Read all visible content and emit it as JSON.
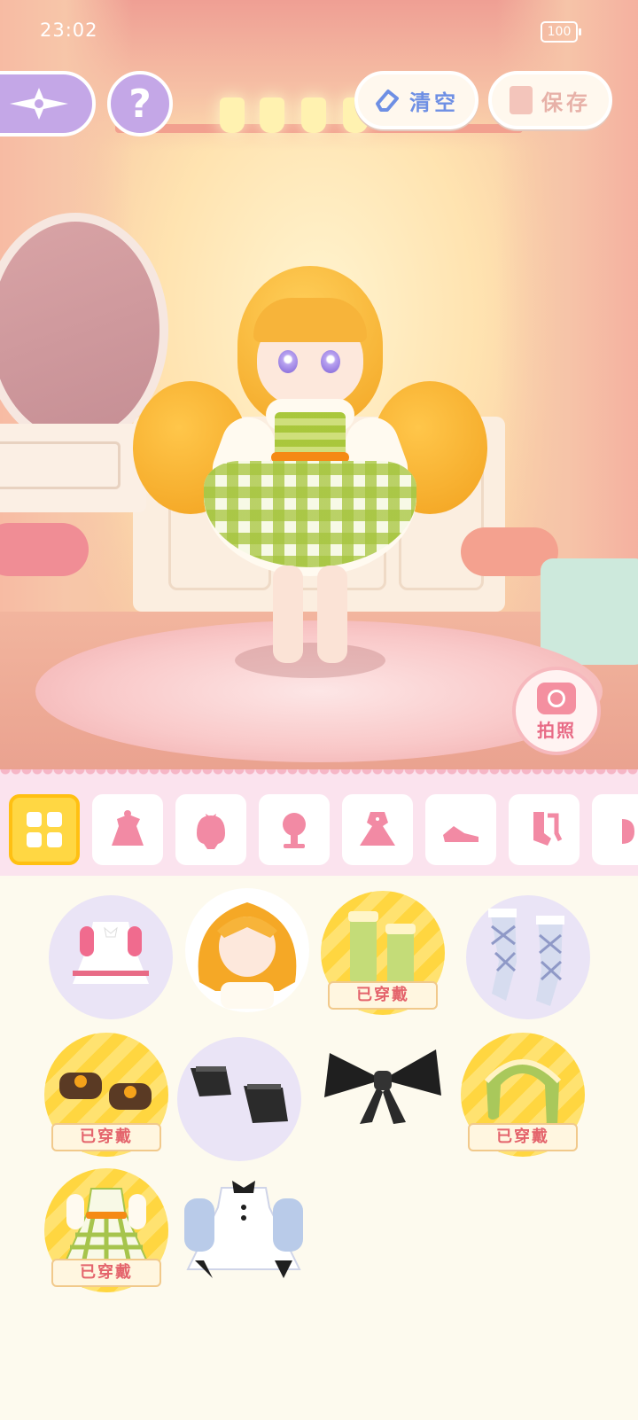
{
  "status": {
    "time": "23:02",
    "battery": "100"
  },
  "top_bar": {
    "clear_label": "清空",
    "save_label": "保存"
  },
  "photo": {
    "label": "拍照"
  },
  "categories": [
    {
      "icon": "all-items-icon",
      "active": true
    },
    {
      "icon": "outfit-set-icon",
      "active": false
    },
    {
      "icon": "hair-accessory-icon",
      "active": false
    },
    {
      "icon": "hairstyle-icon",
      "active": false
    },
    {
      "icon": "dress-icon",
      "active": false
    },
    {
      "icon": "shoe-icon",
      "active": false
    },
    {
      "icon": "sock-icon",
      "active": false
    },
    {
      "icon": "more-category-icon",
      "active": false
    }
  ],
  "items": [
    {
      "name": "pink-white-dress-item",
      "worn": false
    },
    {
      "name": "blonde-twin-hairstyle-item",
      "worn": false
    },
    {
      "name": "green-socks-item",
      "worn": true,
      "label": "已穿戴"
    },
    {
      "name": "argyle-stockings-item",
      "worn": false
    },
    {
      "name": "brown-shoes-item",
      "worn": true,
      "label": "已穿戴"
    },
    {
      "name": "black-shoes-item",
      "worn": false
    },
    {
      "name": "black-bow-item",
      "worn": false
    },
    {
      "name": "green-headband-item",
      "worn": true,
      "label": "已穿戴"
    },
    {
      "name": "green-plaid-dress-item",
      "worn": true,
      "label": "已穿戴"
    },
    {
      "name": "blue-white-dress-item",
      "worn": false
    }
  ],
  "colors": {
    "accent_purple": "#c4a7e7",
    "worn_yellow": "#ffd640",
    "worn_text": "#e4646c",
    "clear_blue": "#6e8fe4"
  }
}
